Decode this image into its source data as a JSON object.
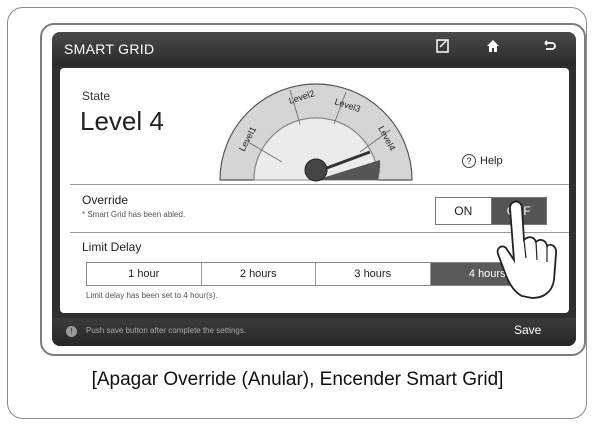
{
  "topbar": {
    "title": "SMART GRID"
  },
  "icons": {
    "edit": "memo-icon",
    "home": "home-icon",
    "back": "back-icon"
  },
  "state": {
    "label": "State",
    "value": "Level 4"
  },
  "gauge": {
    "levels": [
      "Level1",
      "Level2",
      "Level3",
      "Level4"
    ],
    "active_level": 4
  },
  "help": {
    "label": "Help"
  },
  "override": {
    "label": "Override",
    "note": "* Smart Grid has been abled.",
    "on_label": "ON",
    "off_label": "OFF",
    "selected": "OFF"
  },
  "limit_delay": {
    "label": "Limit Delay",
    "options": [
      "1 hour",
      "2 hours",
      "3 hours",
      "4 hours"
    ],
    "selected": "4 hours",
    "note": "Limit delay has been set to 4 hour(s)."
  },
  "bottom": {
    "message": "Push save button after complete the settings.",
    "save_label": "Save"
  },
  "caption": "[Apagar Override (Anular), Encender Smart Grid]",
  "colors": {
    "accent_dark": "#555555",
    "bar": "#2f2f2f"
  }
}
